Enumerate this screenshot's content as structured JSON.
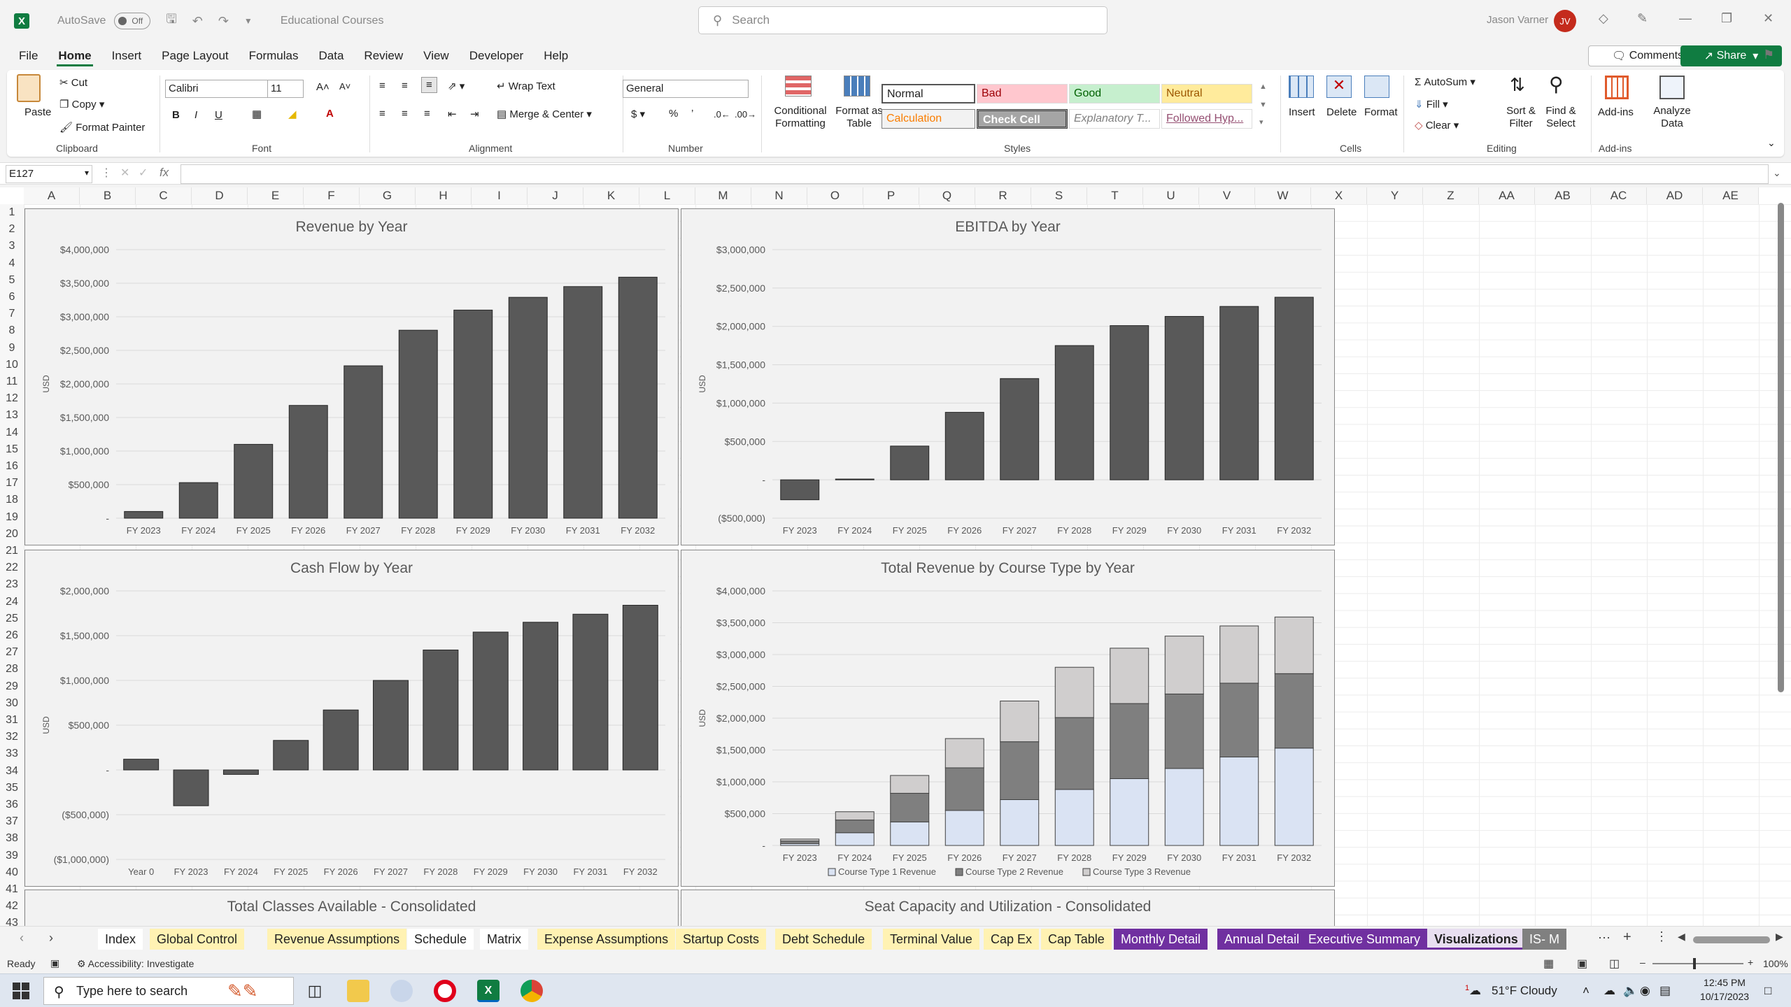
{
  "titlebar": {
    "autosave_label": "AutoSave",
    "autosave_state": "Off",
    "doc_title": "Educational Courses",
    "search_placeholder": "Search",
    "user_name": "Jason Varner",
    "user_initials": "JV"
  },
  "menu": [
    "File",
    "Home",
    "Insert",
    "Page Layout",
    "Formulas",
    "Data",
    "Review",
    "View",
    "Developer",
    "Help"
  ],
  "menu_active": "Home",
  "actions": {
    "comments": "Comments",
    "share": "Share"
  },
  "ribbon": {
    "clipboard": {
      "paste": "Paste",
      "cut": "Cut",
      "copy": "Copy",
      "format_painter": "Format Painter",
      "label": "Clipboard"
    },
    "font": {
      "name": "Calibri",
      "size": "11",
      "label": "Font"
    },
    "alignment": {
      "wrap": "Wrap Text",
      "merge": "Merge & Center",
      "label": "Alignment"
    },
    "number": {
      "format": "General",
      "label": "Number"
    },
    "styles": {
      "conditional": "Conditional Formatting",
      "format_table": "Format as Table",
      "normal": "Normal",
      "bad": "Bad",
      "good": "Good",
      "neutral": "Neutral",
      "calculation": "Calculation",
      "check_cell": "Check Cell",
      "explanatory": "Explanatory T...",
      "followed": "Followed Hyp...",
      "label": "Styles"
    },
    "cells": {
      "insert": "Insert",
      "delete": "Delete",
      "format": "Format",
      "label": "Cells"
    },
    "editing": {
      "autosum": "AutoSum",
      "fill": "Fill",
      "clear": "Clear",
      "sort": "Sort & Filter",
      "find": "Find & Select",
      "label": "Editing"
    },
    "addins": {
      "addins": "Add-ins",
      "analyze": "Analyze Data",
      "label": "Add-ins"
    }
  },
  "formula_bar": {
    "name_box": "E127",
    "fx": "fx",
    "value": ""
  },
  "columns": [
    "A",
    "B",
    "C",
    "D",
    "E",
    "F",
    "G",
    "H",
    "I",
    "J",
    "K",
    "L",
    "M",
    "N",
    "O",
    "P",
    "Q",
    "R",
    "S",
    "T",
    "U",
    "V",
    "W",
    "X",
    "Y",
    "Z",
    "AA",
    "AB",
    "AC",
    "AD",
    "AE"
  ],
  "rows": [
    "1",
    "2",
    "3",
    "4",
    "5",
    "6",
    "7",
    "8",
    "9",
    "10",
    "11",
    "12",
    "13",
    "14",
    "15",
    "16",
    "17",
    "18",
    "19",
    "20",
    "21",
    "22",
    "23",
    "24",
    "25",
    "26",
    "27",
    "28",
    "29",
    "30",
    "31",
    "32",
    "33",
    "34",
    "35",
    "36",
    "37",
    "38",
    "39",
    "40",
    "41",
    "42",
    "43"
  ],
  "chart_data": [
    {
      "type": "bar",
      "title": "Revenue by Year",
      "ylabel": "USD",
      "categories": [
        "FY 2023",
        "FY 2024",
        "FY 2025",
        "FY 2026",
        "FY 2027",
        "FY 2028",
        "FY 2029",
        "FY 2030",
        "FY 2031",
        "FY 2032"
      ],
      "values": [
        100000,
        530000,
        1100000,
        1680000,
        2270000,
        2800000,
        3100000,
        3290000,
        3450000,
        3590000
      ],
      "ylim": [
        0,
        4000000
      ],
      "ticks": [
        "-",
        "$500,000",
        "$1,000,000",
        "$1,500,000",
        "$2,000,000",
        "$2,500,000",
        "$3,000,000",
        "$3,500,000",
        "$4,000,000"
      ],
      "bar_color": "#595959"
    },
    {
      "type": "bar",
      "title": "EBITDA by Year",
      "ylabel": "USD",
      "categories": [
        "FY 2023",
        "FY 2024",
        "FY 2025",
        "FY 2026",
        "FY 2027",
        "FY 2028",
        "FY 2029",
        "FY 2030",
        "FY 2031",
        "FY 2032"
      ],
      "values": [
        -260000,
        10000,
        440000,
        880000,
        1320000,
        1750000,
        2010000,
        2130000,
        2260000,
        2380000
      ],
      "ylim": [
        -500000,
        3000000
      ],
      "ticks": [
        "($500,000)",
        "-",
        "$500,000",
        "$1,000,000",
        "$1,500,000",
        "$2,000,000",
        "$2,500,000",
        "$3,000,000"
      ],
      "bar_color": "#595959"
    },
    {
      "type": "bar",
      "title": "Cash Flow by Year",
      "ylabel": "USD",
      "categories": [
        "Year 0",
        "FY 2023",
        "FY 2024",
        "FY 2025",
        "FY 2026",
        "FY 2027",
        "FY 2028",
        "FY 2029",
        "FY 2030",
        "FY 2031",
        "FY 2032"
      ],
      "values": [
        120000,
        -400000,
        -50000,
        330000,
        670000,
        1000000,
        1340000,
        1540000,
        1650000,
        1740000,
        1840000
      ],
      "ylim": [
        -1000000,
        2000000
      ],
      "ticks": [
        "($1,000,000)",
        "($500,000)",
        "-",
        "$500,000",
        "$1,000,000",
        "$1,500,000",
        "$2,000,000"
      ],
      "bar_color": "#595959"
    },
    {
      "type": "bar",
      "stacked": true,
      "title": "Total Revenue by Course Type by Year",
      "ylabel": "USD",
      "categories": [
        "FY 2023",
        "FY 2024",
        "FY 2025",
        "FY 2026",
        "FY 2027",
        "FY 2028",
        "FY 2029",
        "FY 2030",
        "FY 2031",
        "FY 2032"
      ],
      "series": [
        {
          "name": "Course Type 1 Revenue",
          "color": "#dae3f3",
          "values": [
            30000,
            200000,
            370000,
            550000,
            720000,
            880000,
            1050000,
            1210000,
            1390000,
            1530000
          ]
        },
        {
          "name": "Course Type 2 Revenue",
          "color": "#7f7f7f",
          "values": [
            40000,
            200000,
            450000,
            670000,
            910000,
            1130000,
            1180000,
            1170000,
            1160000,
            1170000
          ]
        },
        {
          "name": "Course Type 3 Revenue",
          "color": "#d0cece",
          "values": [
            30000,
            130000,
            280000,
            460000,
            640000,
            790000,
            870000,
            910000,
            900000,
            890000
          ]
        }
      ],
      "ylim": [
        0,
        4000000
      ],
      "ticks": [
        "-",
        "$500,000",
        "$1,000,000",
        "$1,500,000",
        "$2,000,000",
        "$2,500,000",
        "$3,000,000",
        "$3,500,000",
        "$4,000,000"
      ],
      "legend": "bottom"
    }
  ],
  "partial_charts": {
    "left_title": "Total Classes Available - Consolidated",
    "right_title": "Seat Capacity and Utilization - Consolidated"
  },
  "sheet_tabs": [
    {
      "label": "Index",
      "bg": "#ffffff",
      "fg": "#222222"
    },
    {
      "label": "Global Control",
      "bg": "#fff2b3",
      "fg": "#222222"
    },
    {
      "label": "Revenue Assumptions",
      "bg": "#fff2b3",
      "fg": "#222222"
    },
    {
      "label": "Schedule",
      "bg": "#ffffff",
      "fg": "#222222"
    },
    {
      "label": "Matrix",
      "bg": "#ffffff",
      "fg": "#222222"
    },
    {
      "label": "Expense Assumptions",
      "bg": "#fff2b3",
      "fg": "#222222"
    },
    {
      "label": "Startup Costs",
      "bg": "#fff2b3",
      "fg": "#222222"
    },
    {
      "label": "Debt Schedule",
      "bg": "#fff2b3",
      "fg": "#222222"
    },
    {
      "label": "Terminal Value",
      "bg": "#fff2b3",
      "fg": "#222222"
    },
    {
      "label": "Cap Ex",
      "bg": "#fff2b3",
      "fg": "#222222"
    },
    {
      "label": "Cap Table",
      "bg": "#fff2b3",
      "fg": "#222222"
    },
    {
      "label": "Monthly Detail",
      "bg": "#7030a0",
      "fg": "#ffffff"
    },
    {
      "label": "Annual Detail",
      "bg": "#7030a0",
      "fg": "#ffffff"
    },
    {
      "label": "Executive Summary",
      "bg": "#7030a0",
      "fg": "#ffffff"
    },
    {
      "label": "Visualizations",
      "bg": "#e8dff0",
      "fg": "#222222"
    },
    {
      "label": "IS- M",
      "bg": "#808080",
      "fg": "#ffffff"
    }
  ],
  "active_sheet": "Visualizations",
  "status": {
    "ready": "Ready",
    "accessibility": "Accessibility: Investigate",
    "zoom": "100%"
  },
  "taskbar": {
    "search_placeholder": "Type here to search",
    "weather": "51°F  Cloudy",
    "time": "12:45 PM",
    "date": "10/17/2023",
    "notif_count": "1"
  }
}
